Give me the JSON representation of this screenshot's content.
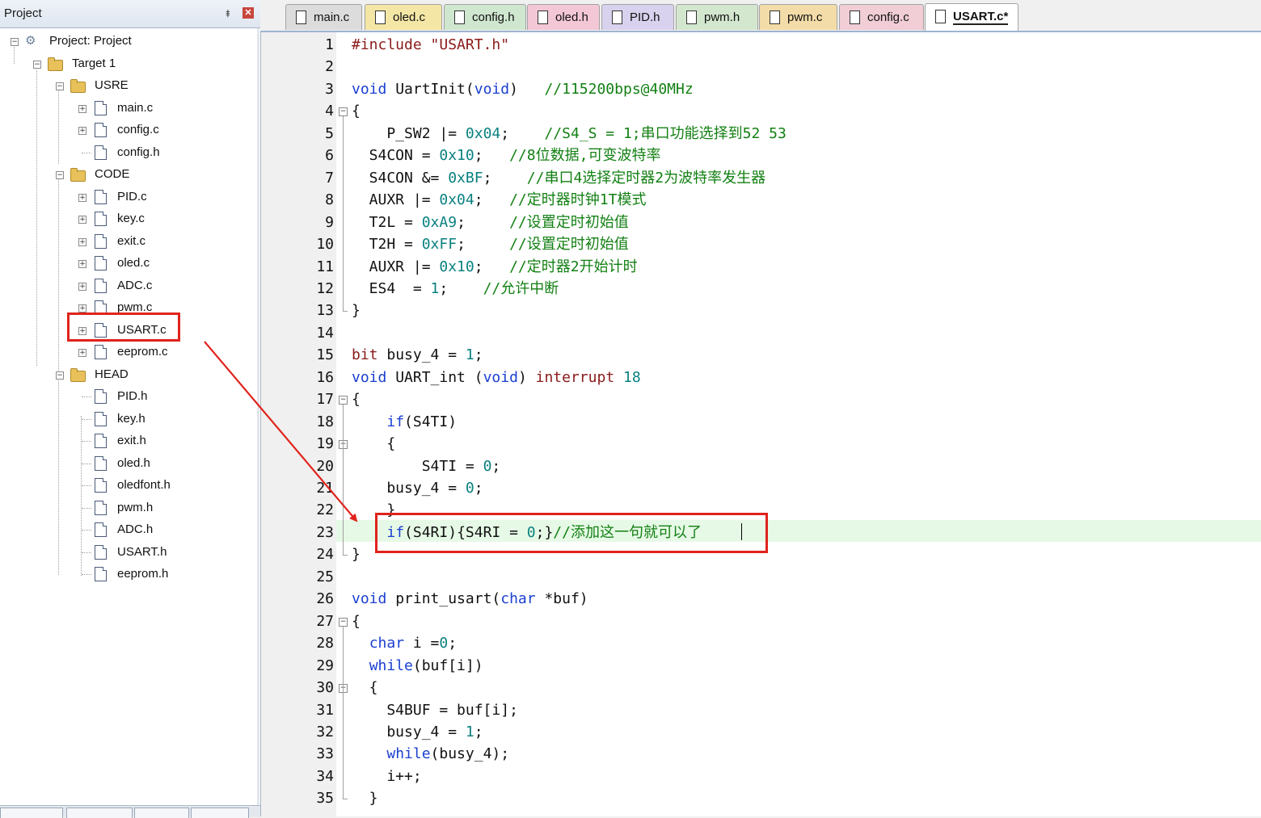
{
  "project_panel": {
    "title": "Project",
    "tree": [
      {
        "label": "Project: Project",
        "kind": "root"
      },
      {
        "label": "Target 1",
        "kind": "target"
      },
      {
        "label": "USRE",
        "kind": "folder"
      },
      {
        "label": "main.c",
        "kind": "file"
      },
      {
        "label": "config.c",
        "kind": "file"
      },
      {
        "label": "config.h",
        "kind": "file"
      },
      {
        "label": "CODE",
        "kind": "folder"
      },
      {
        "label": "PID.c",
        "kind": "file"
      },
      {
        "label": "key.c",
        "kind": "file"
      },
      {
        "label": "exit.c",
        "kind": "file"
      },
      {
        "label": "oled.c",
        "kind": "file"
      },
      {
        "label": "ADC.c",
        "kind": "file"
      },
      {
        "label": "pwm.c",
        "kind": "file"
      },
      {
        "label": "USART.c",
        "kind": "file",
        "highlighted": true
      },
      {
        "label": "eeprom.c",
        "kind": "file"
      },
      {
        "label": "HEAD",
        "kind": "folder"
      },
      {
        "label": "PID.h",
        "kind": "file"
      },
      {
        "label": "key.h",
        "kind": "file"
      },
      {
        "label": "exit.h",
        "kind": "file"
      },
      {
        "label": "oled.h",
        "kind": "file"
      },
      {
        "label": "oledfont.h",
        "kind": "file"
      },
      {
        "label": "pwm.h",
        "kind": "file"
      },
      {
        "label": "ADC.h",
        "kind": "file"
      },
      {
        "label": "USART.h",
        "kind": "file"
      },
      {
        "label": "eeprom.h",
        "kind": "file"
      }
    ]
  },
  "tabs": [
    {
      "label": "main.c",
      "color": "#dcdcdc"
    },
    {
      "label": "oled.c",
      "color": "#f4e7a6"
    },
    {
      "label": "config.h",
      "color": "#cfe6cf"
    },
    {
      "label": "oled.h",
      "color": "#f3c7d6"
    },
    {
      "label": "PID.h",
      "color": "#d9d2ee"
    },
    {
      "label": "pwm.h",
      "color": "#d3e7cf"
    },
    {
      "label": "pwm.c",
      "color": "#f4dca8"
    },
    {
      "label": "config.c",
      "color": "#f1cdd6"
    },
    {
      "label": "USART.c*",
      "color": "#ffffff",
      "active": true
    }
  ],
  "editor": {
    "lines": [
      "#include \"USART.h\"",
      "",
      "void UartInit(void)   //115200bps@40MHz",
      "{",
      "    P_SW2 |= 0x04;    //S4_S = 1;串口功能选择到52 53",
      "  S4CON = 0x10;   //8位数据,可变波特率",
      "  S4CON &= 0xBF;    //串口4选择定时器2为波特率发生器",
      "  AUXR |= 0x04;   //定时器时钟1T模式",
      "  T2L = 0xA9;     //设置定时初始值",
      "  T2H = 0xFF;     //设置定时初始值",
      "  AUXR |= 0x10;   //定时器2开始计时",
      "  ES4  = 1;    //允许中断",
      "}",
      "",
      "bit busy_4 = 1;",
      "void UART_int (void) interrupt 18",
      "{",
      "    if(S4TI)",
      "    {",
      "        S4TI = 0;",
      "    busy_4 = 0;",
      "    }",
      "    if(S4RI){S4RI = 0;}//添加这一句就可以了",
      "}",
      "",
      "void print_usart(char *buf)",
      "{",
      "  char i =0;",
      "  while(buf[i])",
      "  {",
      "    S4BUF = buf[i];",
      "    busy_4 = 1;",
      "    while(busy_4);",
      "    i++;",
      "  }"
    ],
    "current_line": 23
  },
  "colors": {
    "keyword": "#1b3fd0",
    "number": "#0a8080",
    "comment": "#138013",
    "string": "#8b1a1a",
    "annotation": "#e0231c",
    "current_line_bg": "#e6f9e6"
  }
}
